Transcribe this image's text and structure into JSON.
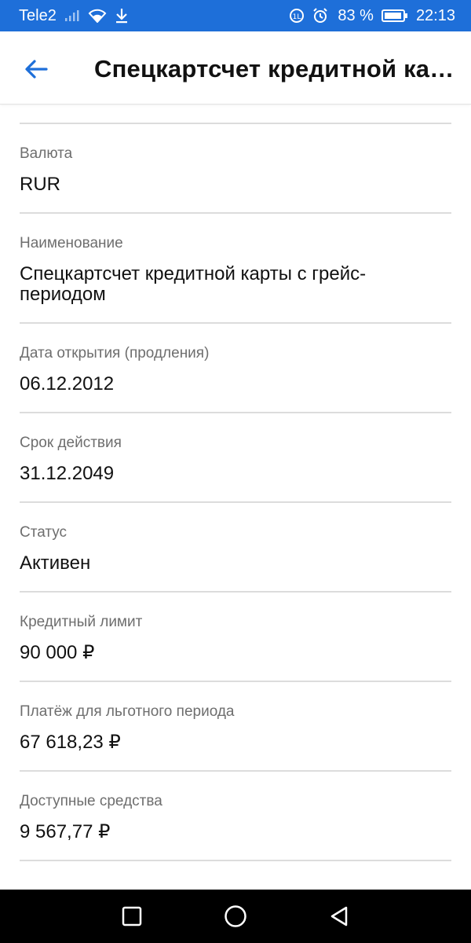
{
  "status_bar": {
    "carrier": "Tele2",
    "battery_percent": "83 %",
    "time": "22:13",
    "icons": [
      "signal-icon",
      "wifi-icon",
      "download-icon",
      "data-saver-icon",
      "alarm-icon",
      "battery-icon"
    ]
  },
  "header": {
    "title": "Спецкартсчет кредитной кар..."
  },
  "fields": [
    {
      "label": "Валюта",
      "value": "RUR"
    },
    {
      "label": "Наименование",
      "value": "Спецкартсчет кредитной карты с грейс-периодом"
    },
    {
      "label": "Дата открытия (продления)",
      "value": "06.12.2012"
    },
    {
      "label": "Срок действия",
      "value": "31.12.2049"
    },
    {
      "label": "Статус",
      "value": "Активен"
    },
    {
      "label": "Кредитный лимит",
      "value": "90 000 ₽"
    },
    {
      "label": "Платёж для льготного периода",
      "value": "67 618,23 ₽"
    },
    {
      "label": "Доступные средства",
      "value": "9 567,77 ₽"
    }
  ],
  "colors": {
    "status_bar": "#1e6fd9",
    "accent": "#1e6fd9",
    "nav_bar": "#000000"
  }
}
